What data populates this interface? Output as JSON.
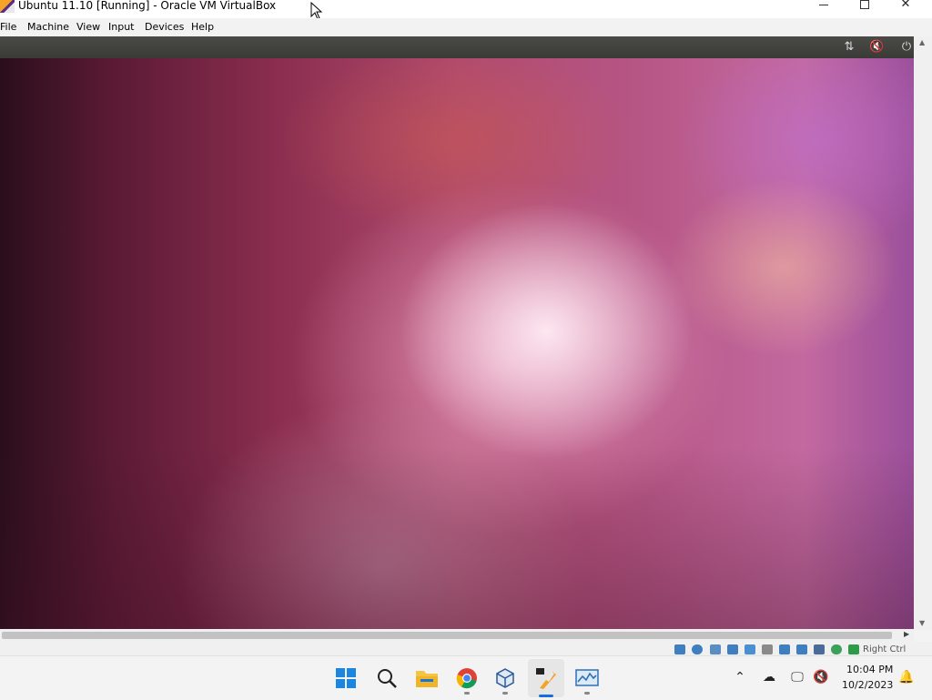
{
  "window": {
    "title": "Ubuntu 11.10 [Running] - Oracle VM VirtualBox",
    "controls": {
      "minimize": "minimize",
      "maximize": "maximize",
      "close": "close"
    }
  },
  "menu": {
    "items": [
      {
        "label": "File"
      },
      {
        "label": "Machine"
      },
      {
        "label": "View"
      },
      {
        "label": "Input"
      },
      {
        "label": "Devices"
      },
      {
        "label": "Help"
      }
    ]
  },
  "guest_topbar": {
    "icons": [
      "network-arrows-icon",
      "volume-muted-icon",
      "power-icon"
    ]
  },
  "statusbar": {
    "icons": [
      "hard-disk-icon",
      "optical-drive-icon",
      "audio-icon",
      "network-icon",
      "usb-icon",
      "shared-folders-icon",
      "display-icon",
      "recording-icon",
      "cpu-icon",
      "mouse-integration-icon",
      "capture-icon"
    ],
    "host_key": "Right Ctrl"
  },
  "taskbar": {
    "apps": [
      "windows-start-icon",
      "search-icon",
      "file-explorer-icon",
      "chrome-icon",
      "virtualbox-manager-icon",
      "virtualbox-vm-icon",
      "performance-monitor-icon"
    ],
    "system_tray": [
      "chevron-up-icon",
      "onedrive-icon",
      "network-icon",
      "volume-muted-icon",
      "notification-bell-icon"
    ],
    "clock": {
      "time": "10:04 PM",
      "date": "10/2/2023"
    }
  },
  "colors": {
    "accent": "#1a6fd6",
    "vm_background_dark": "#2a0e1c",
    "vm_background_light": "#fce8f2"
  }
}
